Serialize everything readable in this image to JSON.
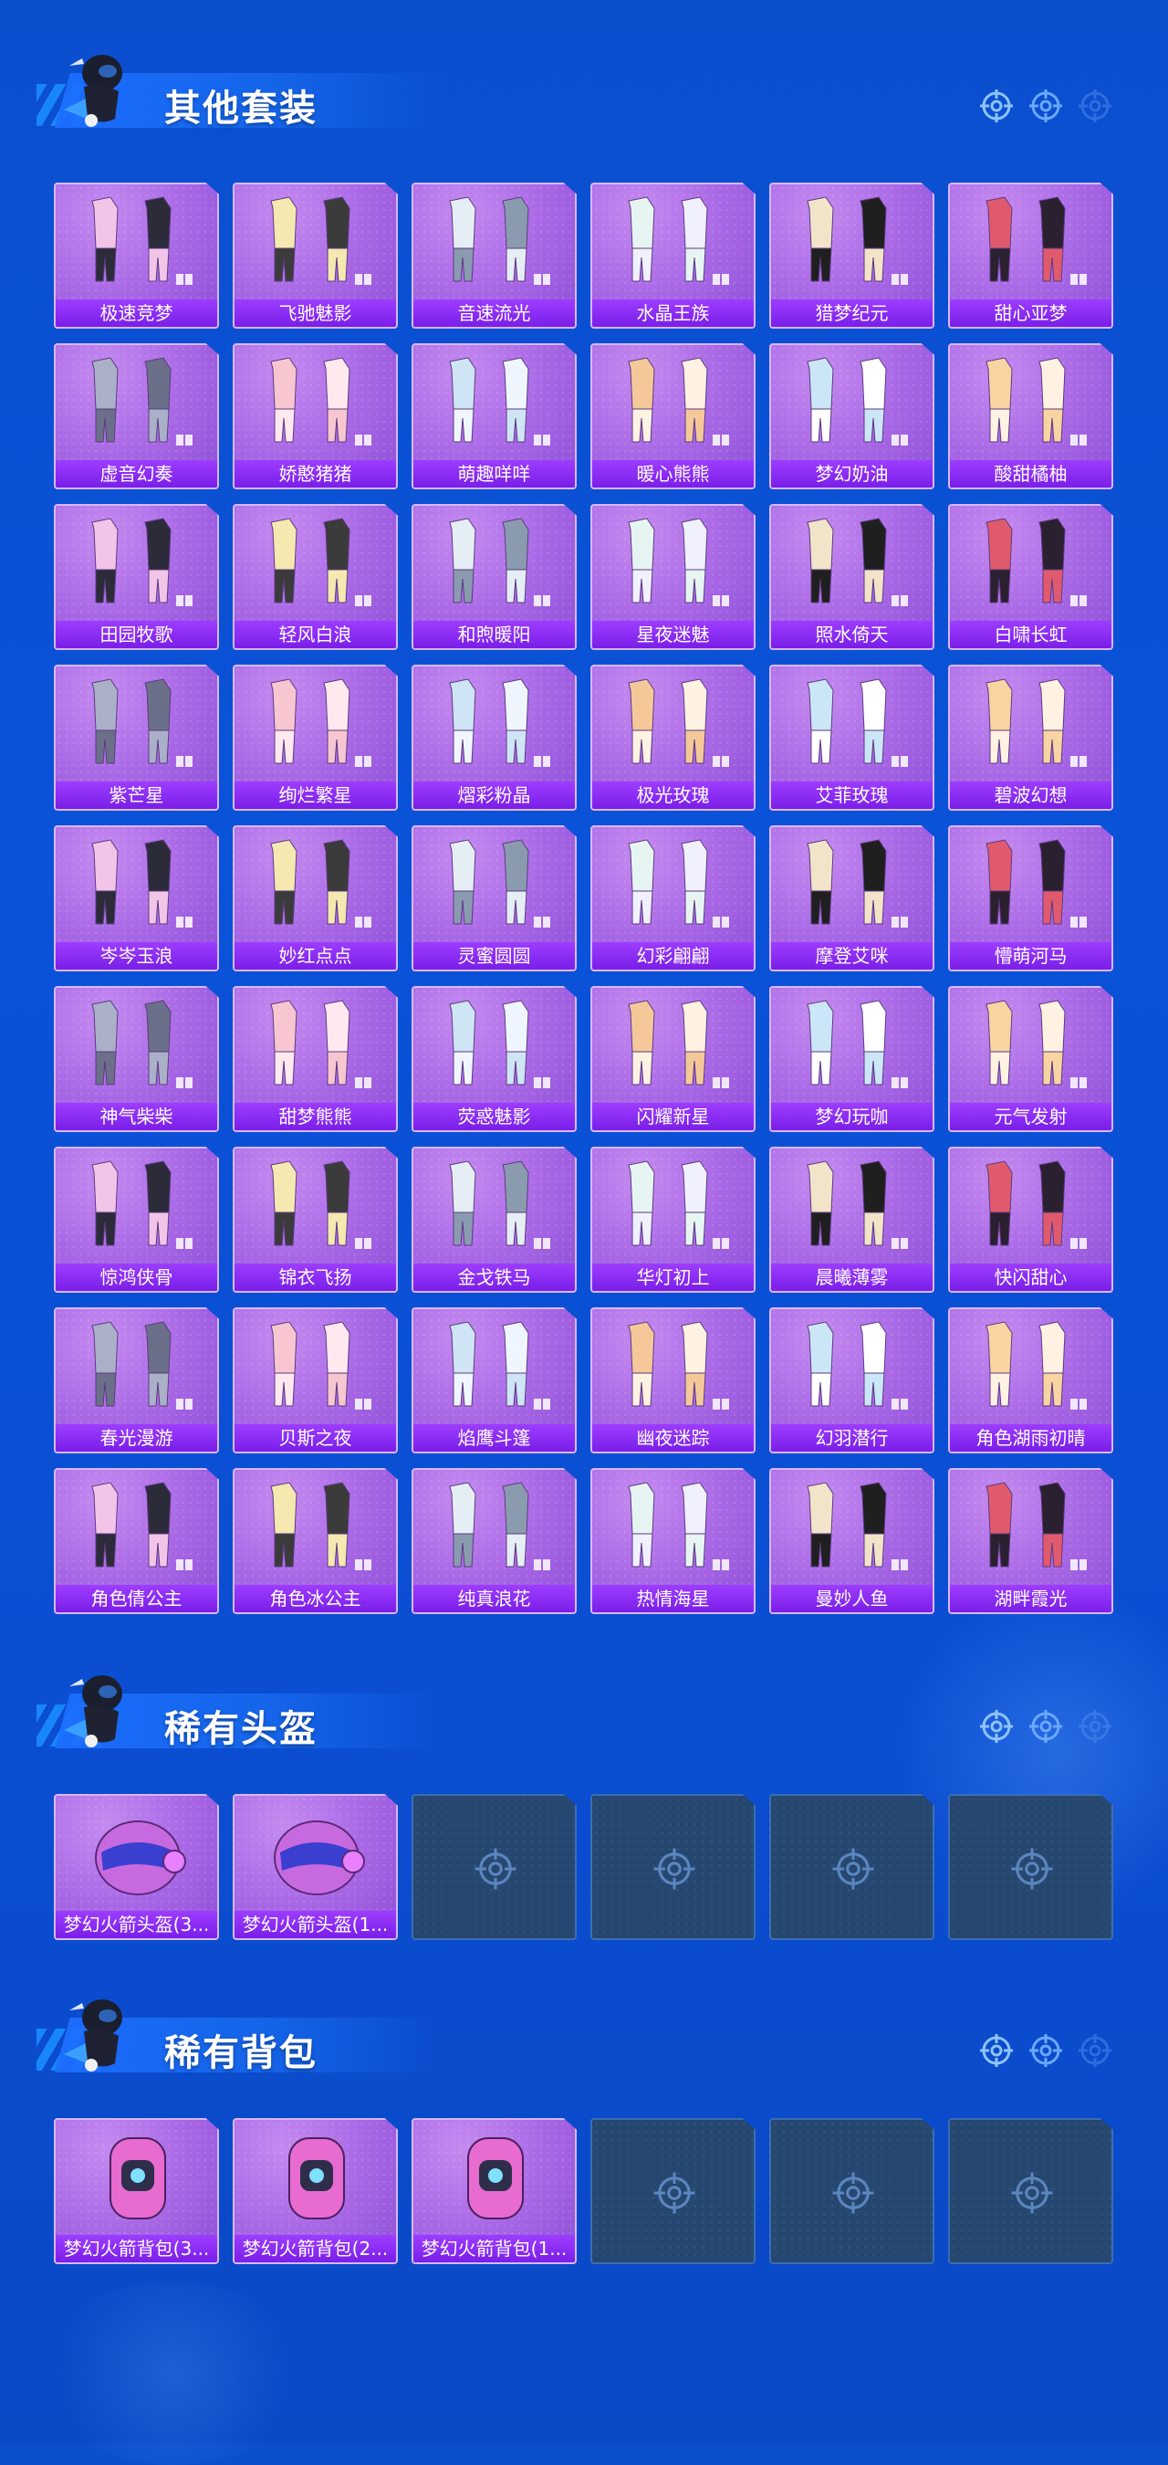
{
  "sections": {
    "suits": {
      "title": "其他套装",
      "items": [
        "极速竞梦",
        "飞驰魅影",
        "音速流光",
        "水晶王族",
        "猎梦纪元",
        "甜心亚梦",
        "虚音幻奏",
        "娇憨猪猪",
        "萌趣咩咩",
        "暖心熊熊",
        "梦幻奶油",
        "酸甜橘柚",
        "田园牧歌",
        "轻风白浪",
        "和煦暖阳",
        "星夜迷魅",
        "照水倚天",
        "白啸长虹",
        "紫芒星",
        "绚烂繁星",
        "熠彩粉晶",
        "极光玫瑰",
        "艾菲玫瑰",
        "碧波幻想",
        "岑岑玉浪",
        "妙红点点",
        "灵蜜圆圆",
        "幻彩翩翩",
        "摩登艾咪",
        "懵萌河马",
        "神气柴柴",
        "甜梦熊熊",
        "荧惑魅影",
        "闪耀新星",
        "梦幻玩咖",
        "元气发射",
        "惊鸿侠骨",
        "锦衣飞扬",
        "金戈铁马",
        "华灯初上",
        "晨曦薄雾",
        "快闪甜心",
        "春光漫游",
        "贝斯之夜",
        "焰鹰斗篷",
        "幽夜迷踪",
        "幻羽潜行",
        "角色湖雨初晴",
        "角色倩公主",
        "角色冰公主",
        "纯真浪花",
        "热情海星",
        "曼妙人鱼",
        "湖畔霞光"
      ]
    },
    "helmets": {
      "title": "稀有头盔",
      "items": [
        "梦幻火箭头盔(3...",
        "梦幻火箭头盔(1..."
      ],
      "empty_count": 4
    },
    "backpacks": {
      "title": "稀有背包",
      "items": [
        "梦幻火箭背包(3...",
        "梦幻火箭背包(2...",
        "梦幻火箭背包(1..."
      ],
      "empty_count": 3
    }
  },
  "icons": {
    "mascot": "mascot-character-icon",
    "target": "crosshair-target-icon"
  },
  "colors": {
    "background": "#0b4fcf",
    "card_purple": "#a969e6",
    "label_purple": "#8a2bf0",
    "empty_slot": "#26476f"
  }
}
